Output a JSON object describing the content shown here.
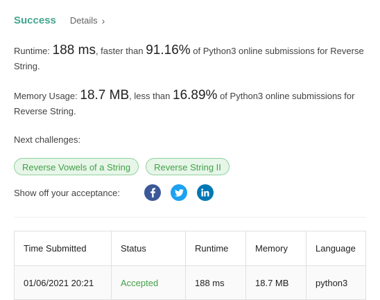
{
  "header": {
    "title": "Success",
    "details_label": "Details"
  },
  "runtime": {
    "label": "Runtime: ",
    "value": "188 ms",
    "mid": ", faster than ",
    "percent": "91.16%",
    "tail": " of Python3 online submissions for Reverse String."
  },
  "memory": {
    "label": "Memory Usage: ",
    "value": "18.7 MB",
    "mid": ", less than ",
    "percent": "16.89%",
    "tail": " of Python3 online submissions for Reverse String."
  },
  "next": {
    "label": "Next challenges:",
    "challenges": [
      "Reverse Vowels of a String",
      "Reverse String II"
    ]
  },
  "share": {
    "label": "Show off your acceptance:",
    "icons": [
      "facebook-icon",
      "twitter-icon",
      "linkedin-icon"
    ],
    "colors": {
      "facebook": "#3b5998",
      "twitter": "#1da1f2",
      "linkedin": "#0077b5"
    }
  },
  "table": {
    "headers": [
      "Time Submitted",
      "Status",
      "Runtime",
      "Memory",
      "Language"
    ],
    "rows": [
      [
        "01/06/2021 20:21",
        "Accepted",
        "188 ms",
        "18.7 MB",
        "python3"
      ]
    ]
  },
  "colors": {
    "success": "#43a58f",
    "accepted": "#43a047",
    "chip_bg": "#e7f6e9",
    "chip_border": "#8fd19b"
  }
}
